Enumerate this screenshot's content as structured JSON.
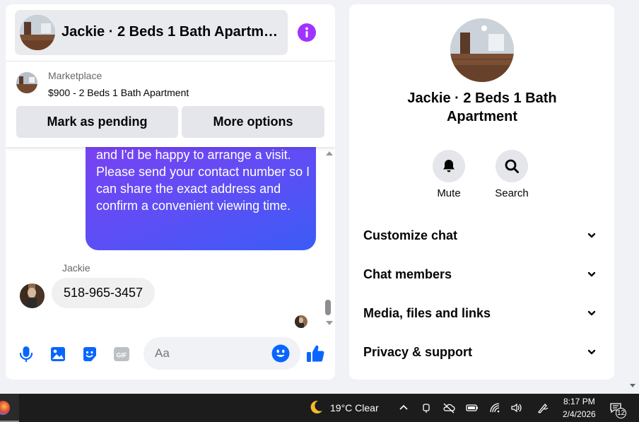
{
  "chat": {
    "title": "Jackie · 2 Beds 1 Bath Apartme…",
    "marketplace_label": "Marketplace",
    "listing": "$900 - 2 Beds 1 Bath Apartment",
    "mark_pending_label": "Mark as pending",
    "more_options_label": "More options",
    "outgoing_message": "interest in the property. It's available, and I'd be happy to arrange a visit. Please send your contact number so I can share the exact address and confirm a convenient viewing time.",
    "sender_name": "Jackie",
    "incoming_message": "518-965-3457",
    "input_placeholder": "Aa"
  },
  "info": {
    "title": "Jackie · 2 Beds 1 Bath Apartment",
    "mute_label": "Mute",
    "search_label": "Search",
    "sections": [
      "Customize chat",
      "Chat members",
      "Media, files and links",
      "Privacy & support"
    ]
  },
  "taskbar": {
    "weather": "19°C  Clear",
    "time": "8:17 PM",
    "date": "2/4/2026",
    "notifications": "12"
  },
  "colors": {
    "accent": "#0866ff",
    "info_icon": "#a033ff",
    "bubble_gradient_start": "#7f3ff2",
    "bubble_gradient_end": "#3b5cf6"
  }
}
